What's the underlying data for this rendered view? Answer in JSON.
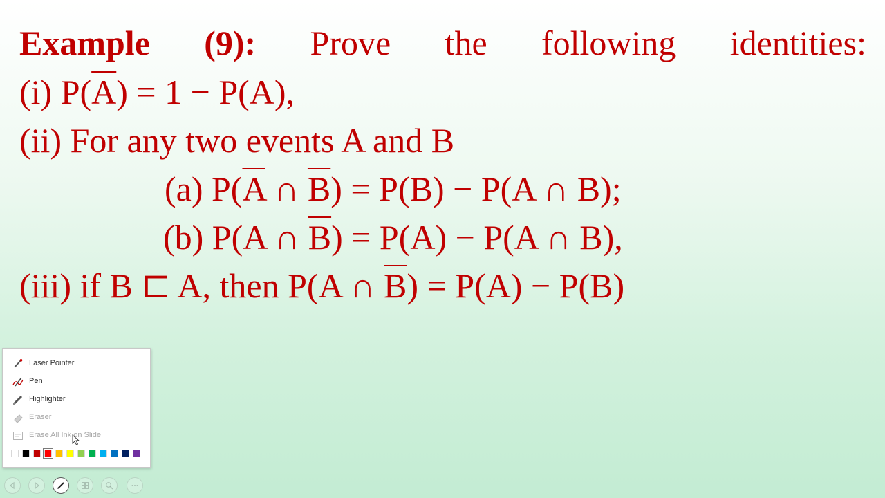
{
  "slide": {
    "title": {
      "label": "Example",
      "number": "(9):",
      "w1": "Prove",
      "w2": "the",
      "w3": "following",
      "w4": "identities:"
    },
    "line1": {
      "a": "(i) P(",
      "b": "A",
      "c": ") = 1 − P(A),"
    },
    "line2": "(ii) For any two events A and B",
    "line3": {
      "a": "(a) P(",
      "b": "A",
      "c": " ∩ ",
      "d": "B",
      "e": ") = P(B) − P(A ∩ B);"
    },
    "line4": {
      "a": "(b) P(A ∩ ",
      "b": "B",
      "c": ") = P(A) − P(A ∩ B),"
    },
    "line5": {
      "a": "(iii) if B ⊏ A, then P(A ∩ ",
      "b": "B",
      "c": ") = P(A) − P(B)"
    },
    "text_color": "#c00000"
  },
  "pen_menu": {
    "items": [
      {
        "label": "Laser Pointer",
        "icon": "laser-pointer-icon",
        "enabled": true
      },
      {
        "label": "Pen",
        "icon": "pen-icon",
        "enabled": true
      },
      {
        "label": "Highlighter",
        "icon": "highlighter-icon",
        "enabled": true
      },
      {
        "label": "Eraser",
        "icon": "eraser-icon",
        "enabled": false
      },
      {
        "label": "Erase All Ink on Slide",
        "icon": "erase-all-icon",
        "enabled": false
      }
    ],
    "colors": [
      "#ffffff",
      "#000000",
      "#c00000",
      "#ff0000",
      "#ffc000",
      "#ffff00",
      "#92d050",
      "#00b050",
      "#00b0f0",
      "#0070c0",
      "#002060",
      "#7030a0"
    ],
    "selected_color": "#ff0000"
  },
  "nav_bar": {
    "buttons": [
      "previous-slide-icon",
      "next-slide-icon",
      "pen-tools-icon",
      "see-all-slides-icon",
      "zoom-icon",
      "more-options-icon"
    ],
    "active": "pen-tools-icon"
  }
}
